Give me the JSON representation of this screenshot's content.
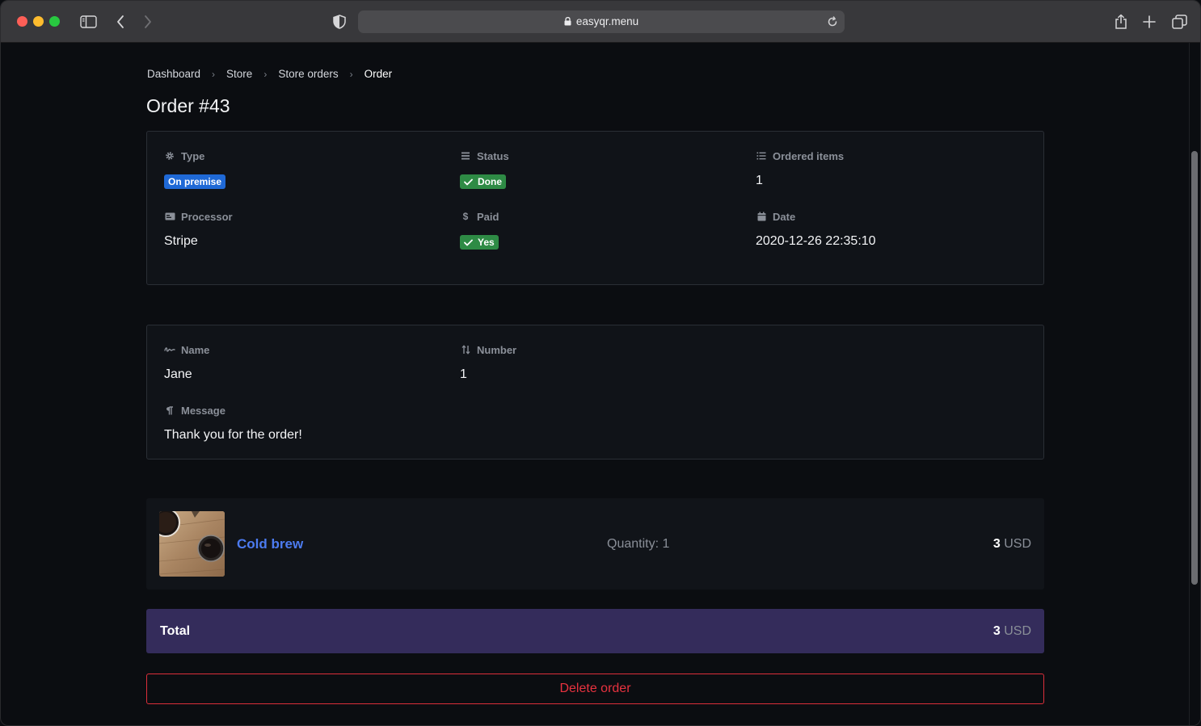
{
  "browser": {
    "url": "easyqr.menu",
    "icons": [
      "sidebar-icon",
      "back-icon",
      "forward-icon",
      "shield-icon",
      "lock-icon",
      "reload-icon",
      "share-icon",
      "new-tab-icon",
      "tabs-overview-icon"
    ]
  },
  "breadcrumb": [
    "Dashboard",
    "Store",
    "Store orders",
    "Order"
  ],
  "page_title": "Order #43",
  "order_info": {
    "type": {
      "label": "Type",
      "value": "On premise",
      "icon": "gear-icon",
      "badge_color": "#1f69d6"
    },
    "status": {
      "label": "Status",
      "value": "Done",
      "icon": "list-icon",
      "badge_color": "#2e8b45"
    },
    "ordered_items": {
      "label": "Ordered items",
      "value": "1",
      "icon": "list-ordered-icon"
    },
    "processor": {
      "label": "Processor",
      "value": "Stripe",
      "icon": "card-icon"
    },
    "paid": {
      "label": "Paid",
      "value": "Yes",
      "icon": "dollar-icon",
      "badge_color": "#2e8b45"
    },
    "date": {
      "label": "Date",
      "value": "2020-12-26 22:35:10",
      "icon": "calendar-icon"
    }
  },
  "customer": {
    "name": {
      "label": "Name",
      "value": "Jane",
      "icon": "signature-icon"
    },
    "number": {
      "label": "Number",
      "value": "1",
      "icon": "sort-icon"
    },
    "message": {
      "label": "Message",
      "value": "Thank you for the order!",
      "icon": "paragraph-icon"
    }
  },
  "items": [
    {
      "name": "Cold brew",
      "quantity": "Quantity: 1",
      "amount": "3",
      "currency": "USD"
    }
  ],
  "total": {
    "label": "Total",
    "amount": "3",
    "currency": "USD"
  },
  "delete_label": "Delete order",
  "colors": {
    "accent_link": "#4c7bf0",
    "danger": "#e8323f",
    "total_bg": "#342c5b"
  }
}
